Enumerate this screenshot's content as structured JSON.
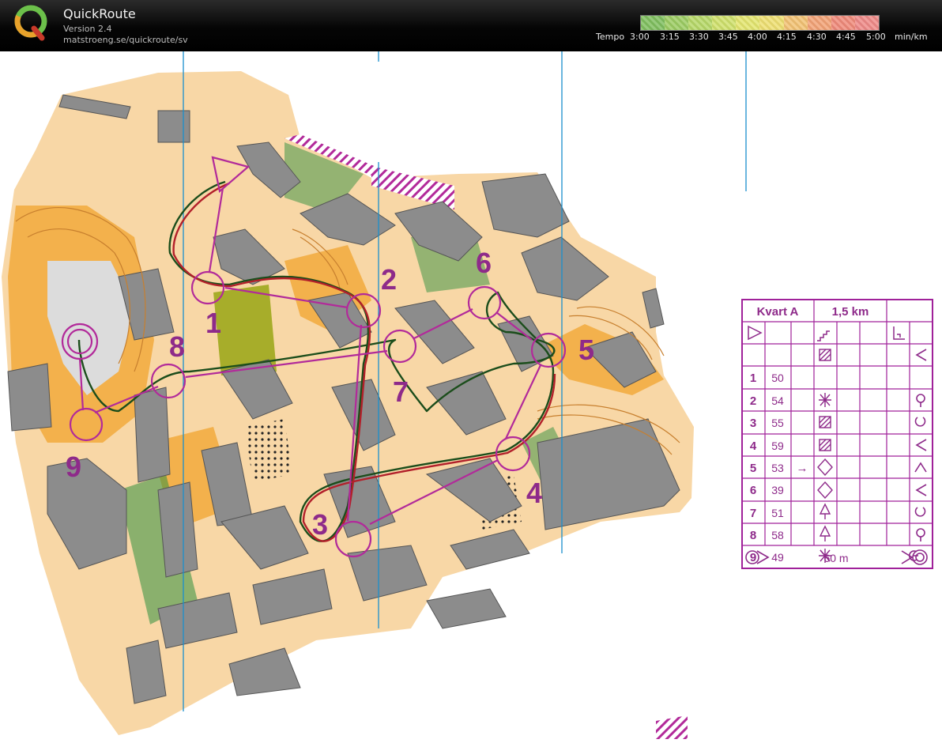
{
  "app": {
    "title": "QuickRoute",
    "version": "Version 2.4",
    "url": "matstroeng.se/quickroute/sv"
  },
  "tempo_legend": {
    "label": "Tempo",
    "ticks": [
      "3:00",
      "3:15",
      "3:30",
      "3:45",
      "4:00",
      "4:15",
      "4:30",
      "4:45",
      "5:00"
    ],
    "unit": "min/km",
    "colors": [
      "#7fbf5f",
      "#9ccc63",
      "#b6d868",
      "#cfe06c",
      "#e3e56f",
      "#eedf72",
      "#f2c274",
      "#f2a276",
      "#ef8a7a",
      "#ee8a88"
    ]
  },
  "map": {
    "colors": {
      "open_land": "#f8d7a6",
      "rough_open": "#f3b14c",
      "building": "#8c8c8c",
      "green": "#2f8f3e",
      "olive": "#a7ad2a",
      "course": "#b22a9a",
      "route_dark": "#1b4d1b",
      "route_red": "#b2202a",
      "grid_line": "#1a8fce"
    },
    "start_label": "start-triangle",
    "finish_label": "finish-double-circle",
    "controls": [
      {
        "number": "1"
      },
      {
        "number": "2"
      },
      {
        "number": "3"
      },
      {
        "number": "4"
      },
      {
        "number": "5"
      },
      {
        "number": "6"
      },
      {
        "number": "7"
      },
      {
        "number": "8"
      },
      {
        "number": "9"
      }
    ]
  },
  "control_card": {
    "course_name": "Kvart A",
    "length": "1,5 km",
    "rows": [
      {
        "num": "1",
        "code": "50",
        "arrow": "",
        "symbol": "hatched-square",
        "position": "left-corner"
      },
      {
        "num": "2",
        "code": "54",
        "arrow": "",
        "symbol": "vegetation-patch",
        "position": "circle-foot"
      },
      {
        "num": "3",
        "code": "55",
        "arrow": "",
        "symbol": "hatched-square",
        "position": "arc"
      },
      {
        "num": "4",
        "code": "59",
        "arrow": "",
        "symbol": "hatched-square",
        "position": "left-corner"
      },
      {
        "num": "5",
        "code": "53",
        "arrow": "→",
        "symbol": "diamond",
        "position": "top-corner"
      },
      {
        "num": "6",
        "code": "39",
        "arrow": "",
        "symbol": "diamond",
        "position": "left-corner"
      },
      {
        "num": "7",
        "code": "51",
        "arrow": "",
        "symbol": "tree",
        "position": "arc"
      },
      {
        "num": "8",
        "code": "58",
        "arrow": "",
        "symbol": "tree",
        "position": "circle-foot"
      },
      {
        "num": "9",
        "code": "49",
        "arrow": "",
        "symbol": "vegetation-patch",
        "position": "arc-left"
      }
    ],
    "footer": "60 m"
  }
}
